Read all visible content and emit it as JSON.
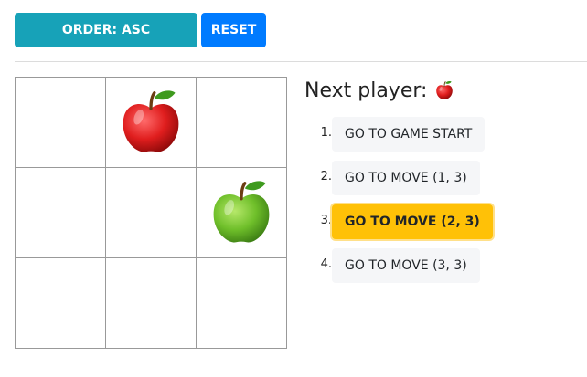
{
  "toolbar": {
    "order_label": "ORDER: ASC",
    "reset_label": "RESET"
  },
  "status": {
    "prefix": "Next player:",
    "player_icon": "red-apple-icon"
  },
  "board": {
    "cells": [
      "",
      "red-apple",
      "",
      "",
      "",
      "green-apple",
      "",
      "",
      ""
    ]
  },
  "moves": [
    {
      "number": "1.",
      "label": "GO TO GAME START",
      "active": false
    },
    {
      "number": "2.",
      "label": "GO TO MOVE (1, 3)",
      "active": false
    },
    {
      "number": "3.",
      "label": "GO TO MOVE (2, 3)",
      "active": true
    },
    {
      "number": "4.",
      "label": "GO TO MOVE (3, 3)",
      "active": false
    }
  ],
  "colors": {
    "order_button": "#17a2b8",
    "reset_button": "#007bff",
    "active_move": "#ffc107",
    "move_button": "#f5f6f8"
  }
}
